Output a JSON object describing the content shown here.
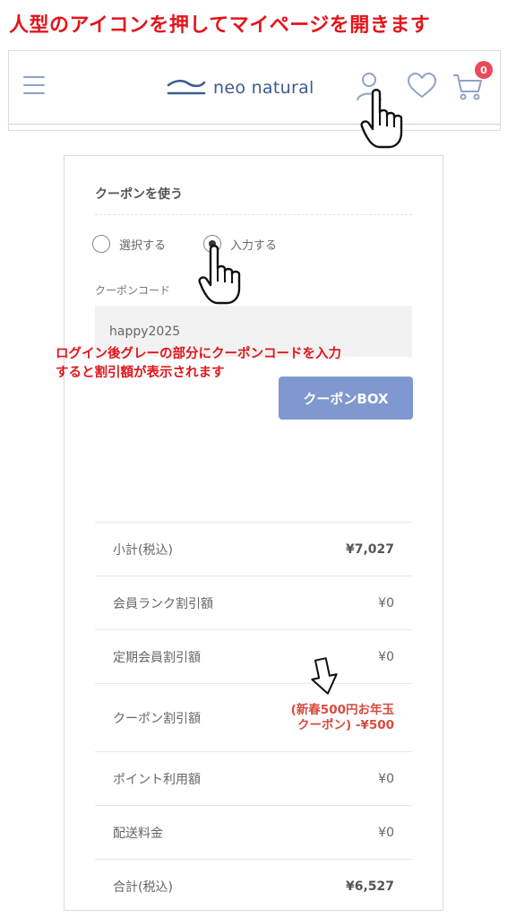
{
  "instructions": {
    "top": "人型のアイコンを押してマイページを開きます",
    "middle_line1": "ログイン後グレーの部分にクーポンコードを入力",
    "middle_line2": "すると割引額が表示されます"
  },
  "header": {
    "logo_text": "neo natural",
    "cart_count": "0",
    "icons": [
      "hamburger-menu-icon",
      "user-icon",
      "heart-icon",
      "cart-icon"
    ]
  },
  "coupon": {
    "section_title": "クーポンを使う",
    "options": [
      {
        "label": "選択する",
        "checked": false
      },
      {
        "label": "入力する",
        "checked": true
      }
    ],
    "field_label": "クーポンコード",
    "field_value": "happy2025",
    "box_button": "クーポンBOX"
  },
  "summary": {
    "rows": [
      {
        "label": "小計(税込)",
        "value": "¥7,027"
      },
      {
        "label": "会員ランク割引額",
        "value": "¥0"
      },
      {
        "label": "定期会員割引額",
        "value": "¥0"
      },
      {
        "label": "クーポン割引額",
        "value_line1": "(新春500円お年玉",
        "value_line2": "クーポン) -¥500"
      },
      {
        "label": "ポイント利用額",
        "value": "¥0"
      },
      {
        "label": "配送料金",
        "value": "¥0"
      },
      {
        "label": "合計(税込)",
        "value": "¥6,527"
      }
    ]
  },
  "colors": {
    "instruction_red": "#e3151b",
    "brand_blue": "#3d5a92",
    "button_blue": "#7f98cf",
    "badge_red": "#ea4a5a",
    "coupon_red": "#d84b3f"
  }
}
